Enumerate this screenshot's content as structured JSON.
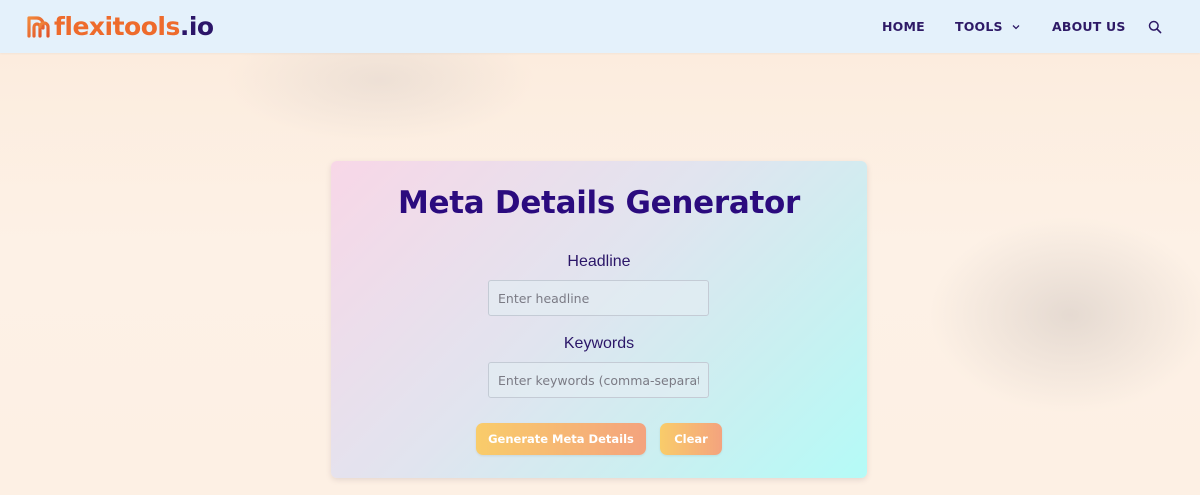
{
  "header": {
    "logo_name": "flexitools",
    "logo_tld": ".io",
    "brand_color": "#ee6b2c",
    "brand_dark": "#2b1568"
  },
  "nav": {
    "home": "HOME",
    "tools": "TOOLS",
    "about": "ABOUT US",
    "search_icon": "search-icon",
    "tools_icon": "chevron-down-icon"
  },
  "tool": {
    "title": "Meta Details Generator",
    "headline_label": "Headline",
    "headline_placeholder": "Enter headline",
    "headline_value": "",
    "keywords_label": "Keywords",
    "keywords_placeholder": "Enter keywords (comma-separated)",
    "keywords_value": "",
    "generate_button": "Generate Meta Details",
    "clear_button": "Clear",
    "title_color": "#2b0b7e",
    "button_gradient": [
      "#f9cc6a",
      "#f4a37e"
    ]
  }
}
